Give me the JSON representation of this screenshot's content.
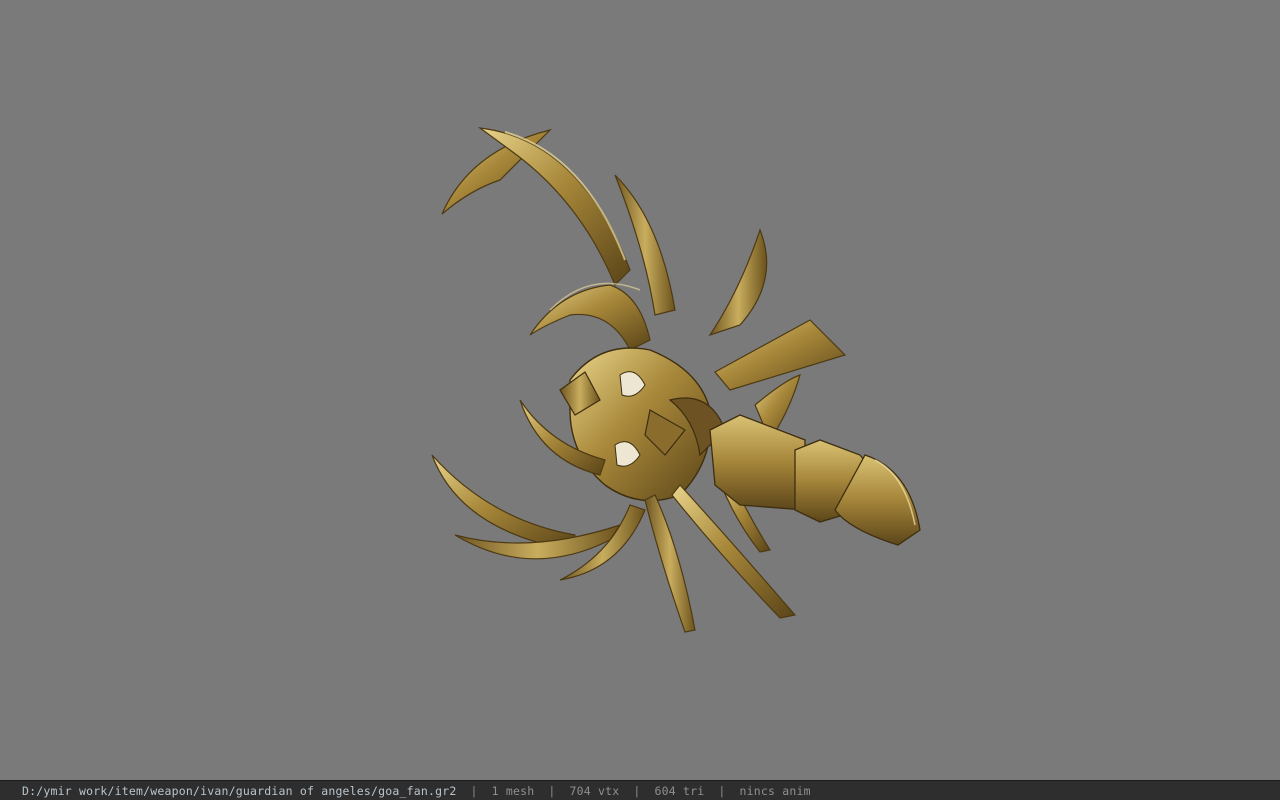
{
  "viewport": {
    "background": "#7a7a7a",
    "model_name": "goa_fan",
    "model_material_color": "#a8883a"
  },
  "status_bar": {
    "file_path": "D:/ymir work/item/weapon/ivan/guardian of angeles/goa_fan.gr2",
    "separator": "|",
    "mesh_count": "1 mesh",
    "vertex_count": "704 vtx",
    "triangle_count": "604 tri",
    "anim_info": "nincs anim"
  }
}
